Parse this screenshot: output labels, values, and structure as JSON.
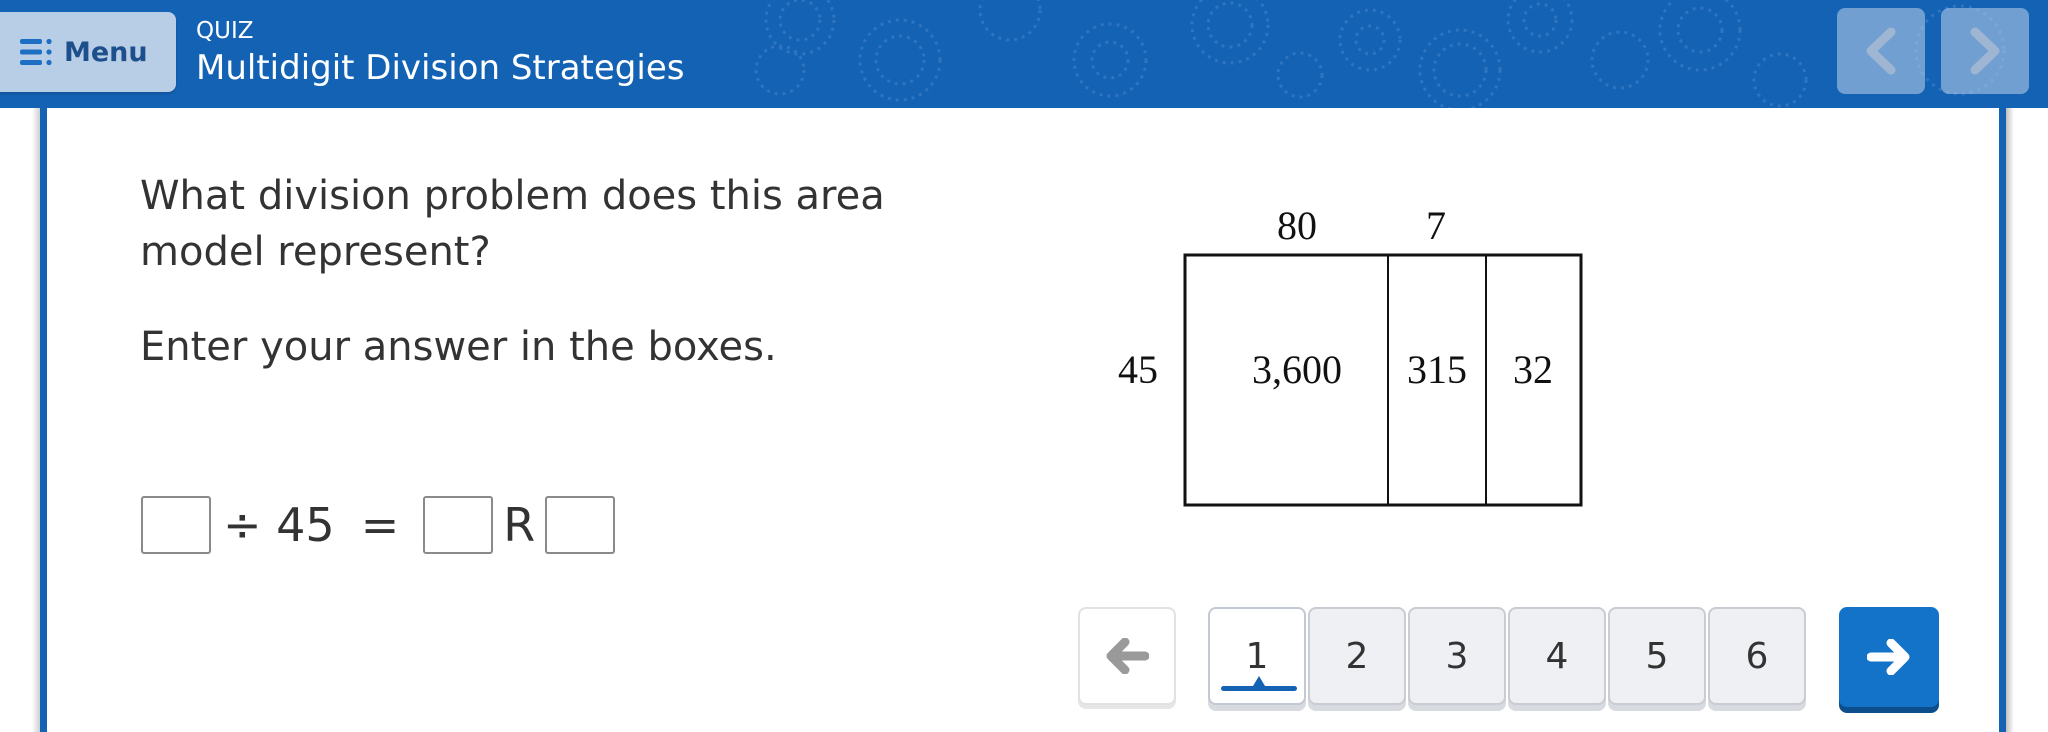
{
  "header": {
    "menu_label": "Menu",
    "quiz_label": "QUIZ",
    "title": "Multidigit Division Strategies",
    "background_color": "#1462b4"
  },
  "question": {
    "prompt": "What division problem does this area model represent?",
    "instruction": "Enter your answer in the boxes.",
    "equation": {
      "dividend": "",
      "operator": "÷ 45",
      "equals": "=",
      "quotient": "",
      "remainder_label": "R",
      "remainder": ""
    }
  },
  "area_model": {
    "top_labels": [
      "80",
      "7"
    ],
    "side_label": "45",
    "cells": [
      "3,600",
      "315",
      "32"
    ]
  },
  "pagination": {
    "pages": [
      "1",
      "2",
      "3",
      "4",
      "5",
      "6"
    ],
    "current_page": "1"
  },
  "icons": {
    "menu": "menu-icon",
    "prev_nav": "chevron-left-icon",
    "next_nav": "chevron-right-icon",
    "pager_prev": "arrow-left-icon",
    "pager_next": "arrow-right-icon"
  },
  "colors": {
    "accent": "#1462b4",
    "next_button": "#1373c9"
  }
}
